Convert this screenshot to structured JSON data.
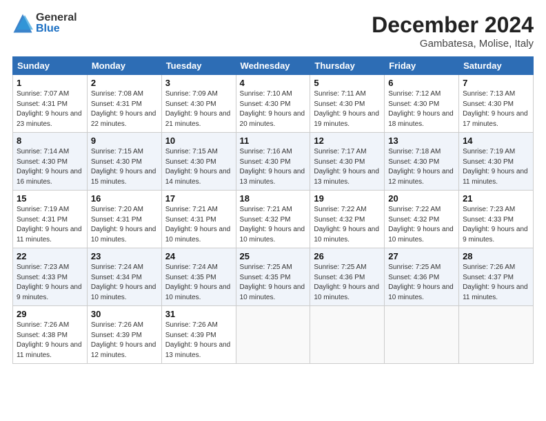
{
  "header": {
    "logo_general": "General",
    "logo_blue": "Blue",
    "month": "December 2024",
    "location": "Gambatesa, Molise, Italy"
  },
  "days_of_week": [
    "Sunday",
    "Monday",
    "Tuesday",
    "Wednesday",
    "Thursday",
    "Friday",
    "Saturday"
  ],
  "weeks": [
    [
      {
        "day": "1",
        "sunrise": "7:07 AM",
        "sunset": "4:31 PM",
        "daylight": "9 hours and 23 minutes."
      },
      {
        "day": "2",
        "sunrise": "7:08 AM",
        "sunset": "4:31 PM",
        "daylight": "9 hours and 22 minutes."
      },
      {
        "day": "3",
        "sunrise": "7:09 AM",
        "sunset": "4:30 PM",
        "daylight": "9 hours and 21 minutes."
      },
      {
        "day": "4",
        "sunrise": "7:10 AM",
        "sunset": "4:30 PM",
        "daylight": "9 hours and 20 minutes."
      },
      {
        "day": "5",
        "sunrise": "7:11 AM",
        "sunset": "4:30 PM",
        "daylight": "9 hours and 19 minutes."
      },
      {
        "day": "6",
        "sunrise": "7:12 AM",
        "sunset": "4:30 PM",
        "daylight": "9 hours and 18 minutes."
      },
      {
        "day": "7",
        "sunrise": "7:13 AM",
        "sunset": "4:30 PM",
        "daylight": "9 hours and 17 minutes."
      }
    ],
    [
      {
        "day": "8",
        "sunrise": "7:14 AM",
        "sunset": "4:30 PM",
        "daylight": "9 hours and 16 minutes."
      },
      {
        "day": "9",
        "sunrise": "7:15 AM",
        "sunset": "4:30 PM",
        "daylight": "9 hours and 15 minutes."
      },
      {
        "day": "10",
        "sunrise": "7:15 AM",
        "sunset": "4:30 PM",
        "daylight": "9 hours and 14 minutes."
      },
      {
        "day": "11",
        "sunrise": "7:16 AM",
        "sunset": "4:30 PM",
        "daylight": "9 hours and 13 minutes."
      },
      {
        "day": "12",
        "sunrise": "7:17 AM",
        "sunset": "4:30 PM",
        "daylight": "9 hours and 13 minutes."
      },
      {
        "day": "13",
        "sunrise": "7:18 AM",
        "sunset": "4:30 PM",
        "daylight": "9 hours and 12 minutes."
      },
      {
        "day": "14",
        "sunrise": "7:19 AM",
        "sunset": "4:30 PM",
        "daylight": "9 hours and 11 minutes."
      }
    ],
    [
      {
        "day": "15",
        "sunrise": "7:19 AM",
        "sunset": "4:31 PM",
        "daylight": "9 hours and 11 minutes."
      },
      {
        "day": "16",
        "sunrise": "7:20 AM",
        "sunset": "4:31 PM",
        "daylight": "9 hours and 10 minutes."
      },
      {
        "day": "17",
        "sunrise": "7:21 AM",
        "sunset": "4:31 PM",
        "daylight": "9 hours and 10 minutes."
      },
      {
        "day": "18",
        "sunrise": "7:21 AM",
        "sunset": "4:32 PM",
        "daylight": "9 hours and 10 minutes."
      },
      {
        "day": "19",
        "sunrise": "7:22 AM",
        "sunset": "4:32 PM",
        "daylight": "9 hours and 10 minutes."
      },
      {
        "day": "20",
        "sunrise": "7:22 AM",
        "sunset": "4:32 PM",
        "daylight": "9 hours and 10 minutes."
      },
      {
        "day": "21",
        "sunrise": "7:23 AM",
        "sunset": "4:33 PM",
        "daylight": "9 hours and 9 minutes."
      }
    ],
    [
      {
        "day": "22",
        "sunrise": "7:23 AM",
        "sunset": "4:33 PM",
        "daylight": "9 hours and 9 minutes."
      },
      {
        "day": "23",
        "sunrise": "7:24 AM",
        "sunset": "4:34 PM",
        "daylight": "9 hours and 10 minutes."
      },
      {
        "day": "24",
        "sunrise": "7:24 AM",
        "sunset": "4:35 PM",
        "daylight": "9 hours and 10 minutes."
      },
      {
        "day": "25",
        "sunrise": "7:25 AM",
        "sunset": "4:35 PM",
        "daylight": "9 hours and 10 minutes."
      },
      {
        "day": "26",
        "sunrise": "7:25 AM",
        "sunset": "4:36 PM",
        "daylight": "9 hours and 10 minutes."
      },
      {
        "day": "27",
        "sunrise": "7:25 AM",
        "sunset": "4:36 PM",
        "daylight": "9 hours and 10 minutes."
      },
      {
        "day": "28",
        "sunrise": "7:26 AM",
        "sunset": "4:37 PM",
        "daylight": "9 hours and 11 minutes."
      }
    ],
    [
      {
        "day": "29",
        "sunrise": "7:26 AM",
        "sunset": "4:38 PM",
        "daylight": "9 hours and 11 minutes."
      },
      {
        "day": "30",
        "sunrise": "7:26 AM",
        "sunset": "4:39 PM",
        "daylight": "9 hours and 12 minutes."
      },
      {
        "day": "31",
        "sunrise": "7:26 AM",
        "sunset": "4:39 PM",
        "daylight": "9 hours and 13 minutes."
      },
      null,
      null,
      null,
      null
    ]
  ]
}
